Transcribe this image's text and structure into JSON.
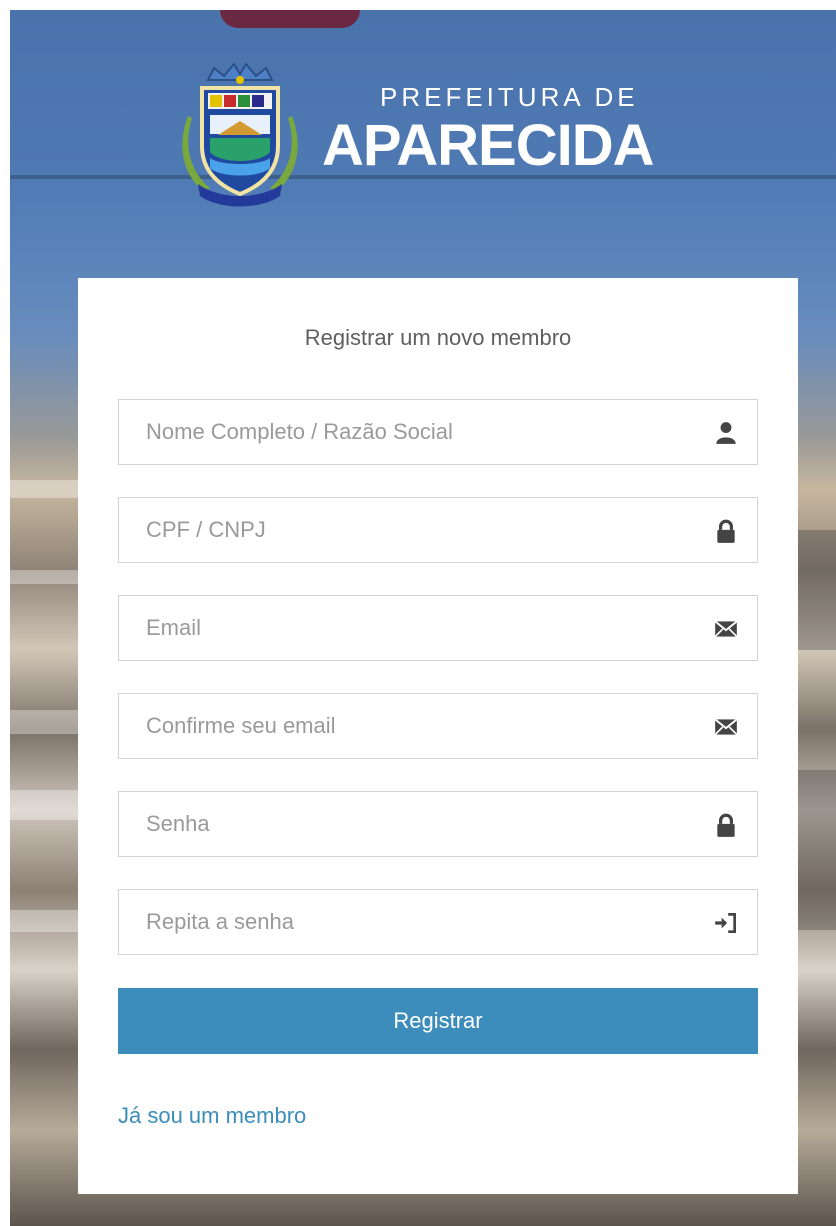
{
  "brand": {
    "line1": "PREFEITURA DE",
    "line2": "APARECIDA"
  },
  "form": {
    "title": "Registrar um novo membro",
    "fields": [
      {
        "placeholder": "Nome Completo / Razão Social",
        "icon": "user-icon"
      },
      {
        "placeholder": "CPF / CNPJ",
        "icon": "lock-icon"
      },
      {
        "placeholder": "Email",
        "icon": "envelope-icon"
      },
      {
        "placeholder": "Confirme seu email",
        "icon": "envelope-icon"
      },
      {
        "placeholder": "Senha",
        "icon": "lock-icon"
      },
      {
        "placeholder": "Repita a senha",
        "icon": "log-in-icon"
      }
    ],
    "submit_label": "Registrar",
    "member_link": "Já sou um membro"
  },
  "colors": {
    "accent": "#3c8dbc",
    "background_blue": "#4f79b3",
    "placeholder": "#9a9a9a",
    "icon": "#444444"
  }
}
